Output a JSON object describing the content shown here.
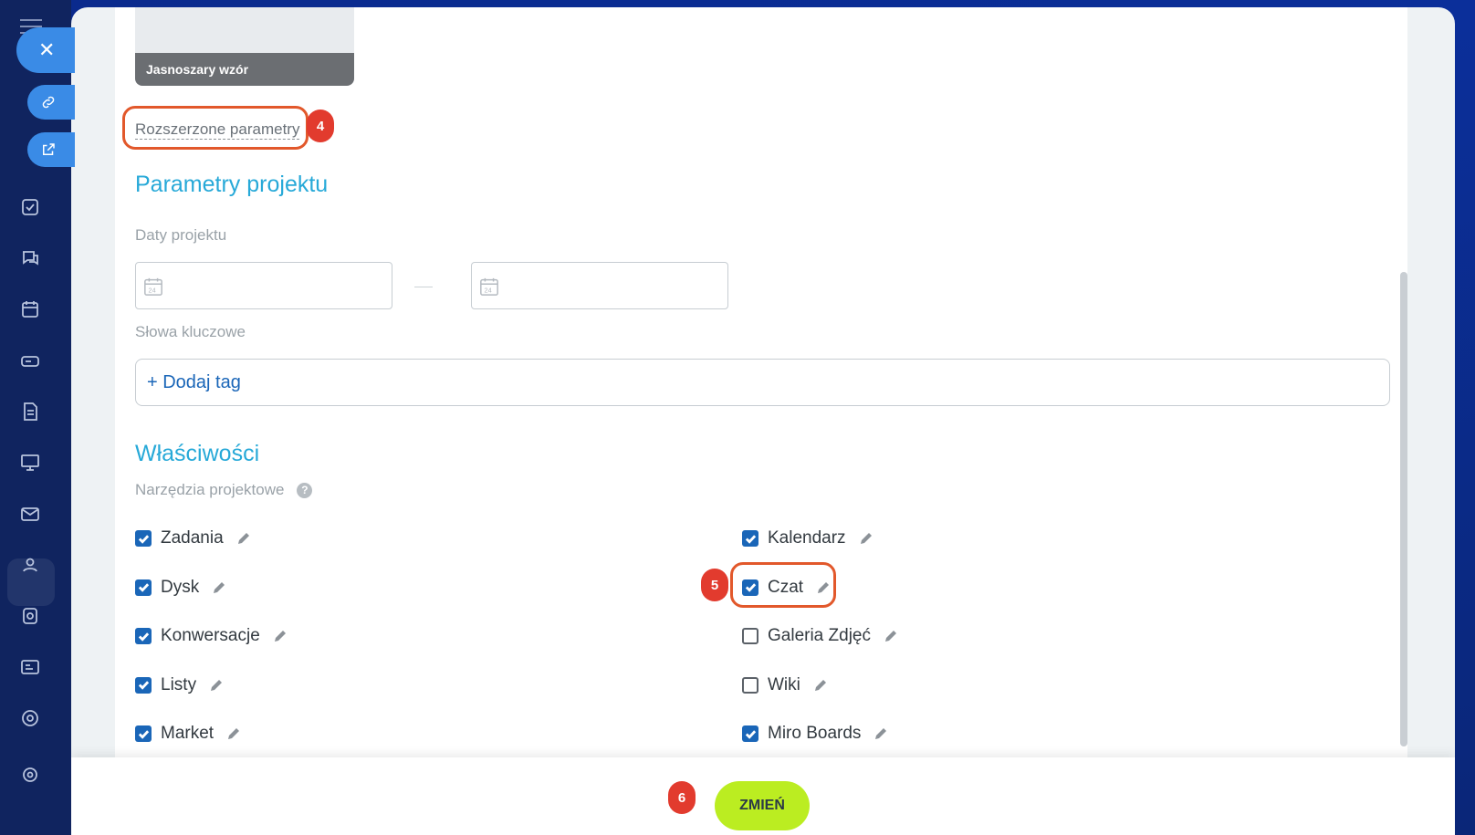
{
  "theme_thumbnail": {
    "label": "Jasnoszary wzór"
  },
  "advanced_link": "Rozszerzone parametry",
  "annotations": {
    "step4": "4",
    "step5": "5",
    "step6": "6"
  },
  "project_params": {
    "title": "Parametry projektu",
    "dates_label": "Daty projektu",
    "keywords_label": "Słowa kluczowe",
    "add_tag": "+ Dodaj tag"
  },
  "properties": {
    "title": "Właściwości",
    "tools_label": "Narzędzia projektowe",
    "help": "?",
    "tools_left": [
      {
        "label": "Zadania",
        "checked": true
      },
      {
        "label": "Dysk",
        "checked": true
      },
      {
        "label": "Konwersacje",
        "checked": true
      },
      {
        "label": "Listy",
        "checked": true
      },
      {
        "label": "Market",
        "checked": true
      }
    ],
    "tools_right": [
      {
        "label": "Kalendarz",
        "checked": true
      },
      {
        "label": "Czat",
        "checked": true
      },
      {
        "label": "Galeria Zdjęć",
        "checked": false
      },
      {
        "label": "Wiki",
        "checked": false
      },
      {
        "label": "Miro Boards",
        "checked": true
      }
    ]
  },
  "footer": {
    "save_label": "ZMIEŃ"
  },
  "colors": {
    "accent": "#27a9d8",
    "save": "#bbed21",
    "checkbox": "#1a66b8",
    "annotation": "#e23b2e"
  }
}
